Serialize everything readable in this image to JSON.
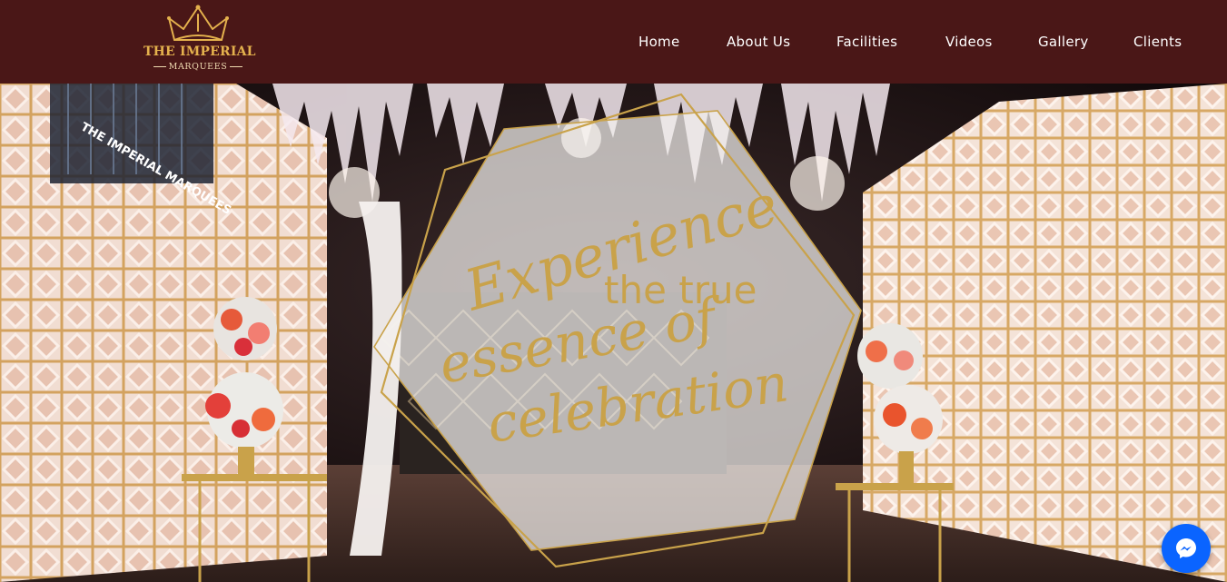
{
  "brand": {
    "logo_line1": "THE IMPERIAL",
    "logo_line2": "MARQUEES",
    "icon": "crown-icon"
  },
  "nav": {
    "items": [
      {
        "label": "Home"
      },
      {
        "label": "About Us"
      },
      {
        "label": "Facilities"
      },
      {
        "label": "Videos"
      },
      {
        "label": "Gallery"
      },
      {
        "label": "Clients"
      }
    ]
  },
  "hero": {
    "headline_1": "Experience",
    "headline_2": "the true",
    "headline_3": "essence of",
    "headline_4": "celebration",
    "venue_sign": "THE IMPERIAL MARQUEES"
  },
  "chat": {
    "icon": "messenger-icon"
  },
  "colors": {
    "header_bg": "#4a1717",
    "gold": "#c9a24a",
    "logo_gold": "#e4b14d",
    "messenger_blue": "#0a64ff"
  }
}
